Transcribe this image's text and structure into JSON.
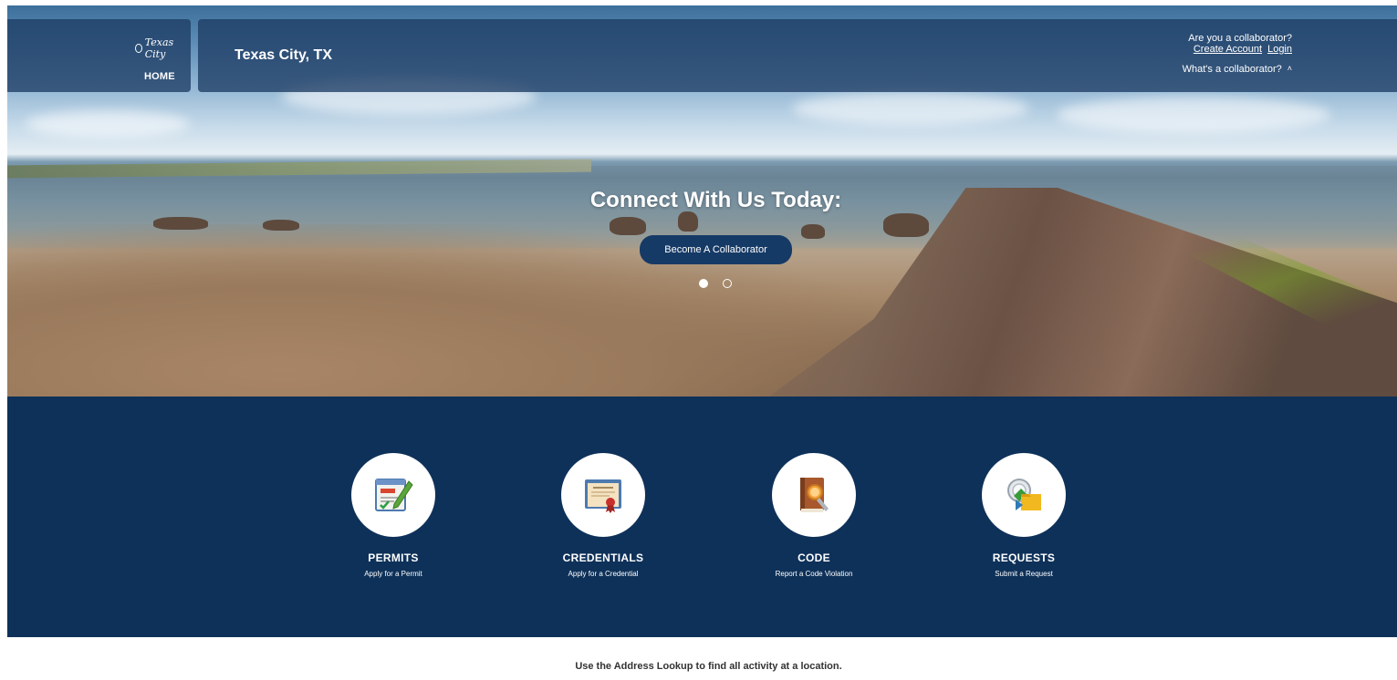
{
  "header": {
    "logo_text": "Texas City",
    "home_label": "HOME",
    "city_title": "Texas City, TX",
    "collaborator_question": "Are you a collaborator?",
    "create_account_label": "Create Account",
    "login_label": "Login",
    "whats_collaborator_label": "What's a collaborator?"
  },
  "hero": {
    "title": "Connect With Us Today:",
    "cta_label": "Become A Collaborator",
    "slides": 2,
    "active_slide": 1
  },
  "services": [
    {
      "name": "PERMITS",
      "subtitle": "Apply for a Permit",
      "icon": "permit-icon"
    },
    {
      "name": "CREDENTIALS",
      "subtitle": "Apply for a Credential",
      "icon": "certificate-icon"
    },
    {
      "name": "CODE",
      "subtitle": "Report a Code Violation",
      "icon": "code-book-icon"
    },
    {
      "name": "REQUESTS",
      "subtitle": "Submit a Request",
      "icon": "request-folder-icon"
    }
  ],
  "footer": {
    "lookup_text": "Use the Address Lookup to find all activity at a location."
  },
  "colors": {
    "header_bg": "#1e3c64",
    "services_bg": "#0e3159",
    "cta_bg": "#163a66"
  }
}
